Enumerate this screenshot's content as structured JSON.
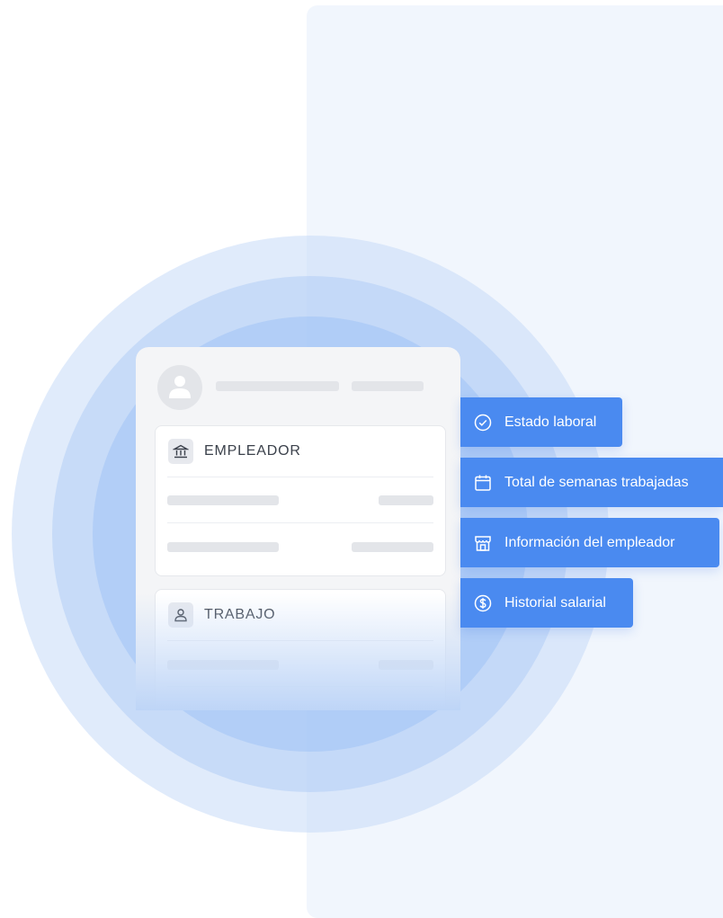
{
  "card": {
    "employer_section": {
      "title": "EMPLEADOR",
      "icon": "bank-icon"
    },
    "job_section": {
      "title": "TRABAJO",
      "icon": "user-icon"
    }
  },
  "tags": [
    {
      "label": "Estado laboral",
      "icon": "check-circle-icon"
    },
    {
      "label": "Total de semanas trabajadas",
      "icon": "calendar-icon"
    },
    {
      "label": "Información del empleador",
      "icon": "store-icon"
    },
    {
      "label": "Historial salarial",
      "icon": "dollar-circle-icon"
    }
  ],
  "colors": {
    "accent": "#4a8af0",
    "background_panel": "#f1f6fd",
    "card": "#f4f5f7",
    "placeholder": "#e3e5e9"
  }
}
